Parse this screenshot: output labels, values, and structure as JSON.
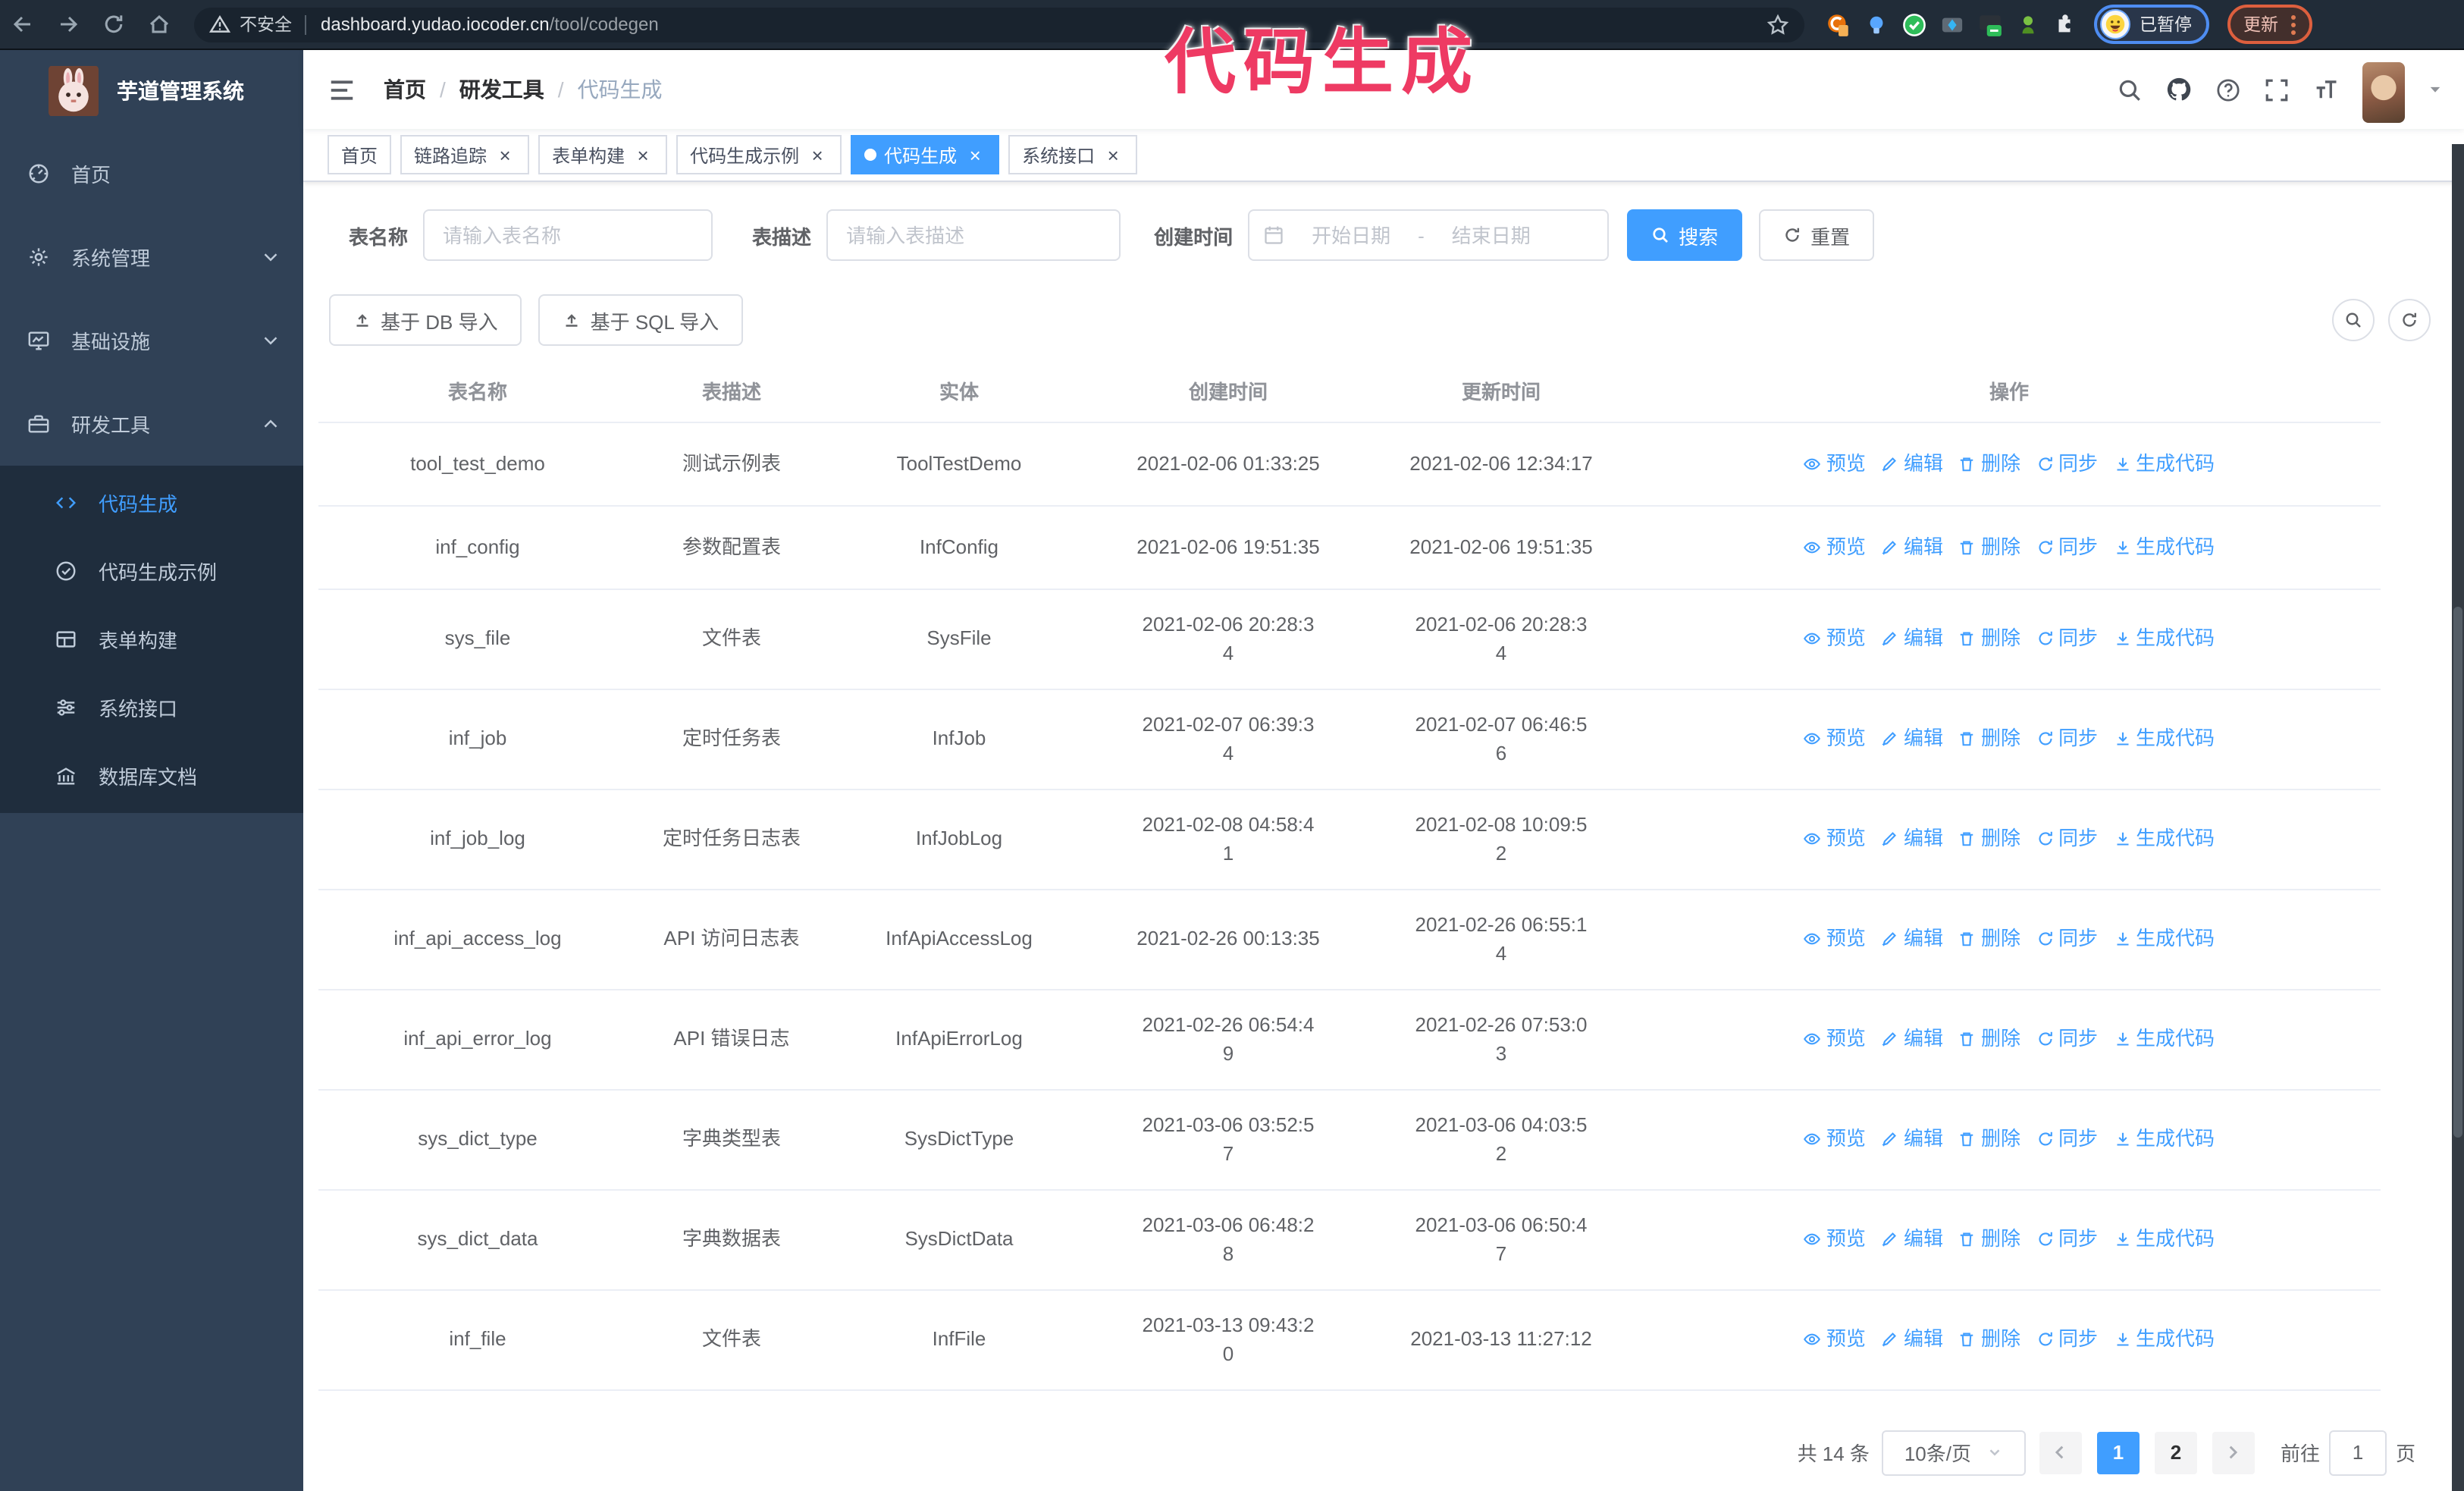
{
  "browser": {
    "security_label": "不安全",
    "url_host": "dashboard.yudao.iocoder.cn",
    "url_path": "/tool/codegen",
    "profile_badge": "已暂停",
    "update_label": "更新"
  },
  "annotation": {
    "text": "代码生成",
    "color": "#ee3a63"
  },
  "sidebar": {
    "title": "芋道管理系统",
    "items": [
      {
        "id": "home",
        "label": "首页",
        "icon": "dashboard-icon"
      },
      {
        "id": "system-mgmt",
        "label": "系统管理",
        "icon": "gear-icon",
        "arrow": "down"
      },
      {
        "id": "infrastructure",
        "label": "基础设施",
        "icon": "monitor-icon",
        "arrow": "down"
      },
      {
        "id": "dev-tools",
        "label": "研发工具",
        "icon": "suitcase-icon",
        "arrow": "up",
        "expanded": true
      }
    ],
    "submenu": [
      {
        "id": "codegen",
        "label": "代码生成",
        "icon": "code-icon",
        "active": true
      },
      {
        "id": "codegen-demo",
        "label": "代码生成示例",
        "icon": "badge-check-icon"
      },
      {
        "id": "form-builder",
        "label": "表单构建",
        "icon": "form-icon"
      },
      {
        "id": "system-api",
        "label": "系统接口",
        "icon": "sliders-icon"
      },
      {
        "id": "db-doc",
        "label": "数据库文档",
        "icon": "bank-icon"
      }
    ]
  },
  "header": {
    "breadcrumb": [
      "首页",
      "研发工具",
      "代码生成"
    ],
    "separator": "/"
  },
  "tabs": [
    {
      "label": "首页",
      "closable": false,
      "active": false
    },
    {
      "label": "链路追踪",
      "closable": true,
      "active": false
    },
    {
      "label": "表单构建",
      "closable": true,
      "active": false
    },
    {
      "label": "代码生成示例",
      "closable": true,
      "active": false
    },
    {
      "label": "代码生成",
      "closable": true,
      "active": true
    },
    {
      "label": "系统接口",
      "closable": true,
      "active": false
    }
  ],
  "ui": {
    "close_glyph": "×"
  },
  "filter": {
    "name_label": "表名称",
    "name_placeholder": "请输入表名称",
    "desc_label": "表描述",
    "desc_placeholder": "请输入表描述",
    "time_label": "创建时间",
    "start_placeholder": "开始日期",
    "range_separator": "-",
    "end_placeholder": "结束日期",
    "search_label": "搜索",
    "reset_label": "重置"
  },
  "toolbar": {
    "import_db_label": "基于 DB 导入",
    "import_sql_label": "基于 SQL 导入"
  },
  "table": {
    "columns": [
      "表名称",
      "表描述",
      "实体",
      "创建时间",
      "更新时间",
      "操作"
    ],
    "actions": [
      {
        "label": "预览",
        "icon": "eye-icon"
      },
      {
        "label": "编辑",
        "icon": "edit-icon"
      },
      {
        "label": "删除",
        "icon": "trash-icon"
      },
      {
        "label": "同步",
        "icon": "sync-icon"
      },
      {
        "label": "生成代码",
        "icon": "download-icon"
      }
    ],
    "rows": [
      {
        "name": "tool_test_demo",
        "desc": "测试示例表",
        "entity": "ToolTestDemo",
        "created": "2021-02-06 01:33:25",
        "updated": "2021-02-06 12:34:17"
      },
      {
        "name": "inf_config",
        "desc": "参数配置表",
        "entity": "InfConfig",
        "created": "2021-02-06 19:51:35",
        "updated": "2021-02-06 19:51:35"
      },
      {
        "name": "sys_file",
        "desc": "文件表",
        "entity": "SysFile",
        "created": "2021-02-06 20:28:3\n4",
        "updated": "2021-02-06 20:28:3\n4"
      },
      {
        "name": "inf_job",
        "desc": "定时任务表",
        "entity": "InfJob",
        "created": "2021-02-07 06:39:3\n4",
        "updated": "2021-02-07 06:46:5\n6"
      },
      {
        "name": "inf_job_log",
        "desc": "定时任务日志表",
        "entity": "InfJobLog",
        "created": "2021-02-08 04:58:4\n1",
        "updated": "2021-02-08 10:09:5\n2"
      },
      {
        "name": "inf_api_access_log",
        "desc": "API 访问日志表",
        "entity": "InfApiAccessLog",
        "created": "2021-02-26 00:13:35",
        "updated": "2021-02-26 06:55:1\n4"
      },
      {
        "name": "inf_api_error_log",
        "desc": "API 错误日志",
        "entity": "InfApiErrorLog",
        "created": "2021-02-26 06:54:4\n9",
        "updated": "2021-02-26 07:53:0\n3"
      },
      {
        "name": "sys_dict_type",
        "desc": "字典类型表",
        "entity": "SysDictType",
        "created": "2021-03-06 03:52:5\n7",
        "updated": "2021-03-06 04:03:5\n2"
      },
      {
        "name": "sys_dict_data",
        "desc": "字典数据表",
        "entity": "SysDictData",
        "created": "2021-03-06 06:48:2\n8",
        "updated": "2021-03-06 06:50:4\n7"
      },
      {
        "name": "inf_file",
        "desc": "文件表",
        "entity": "InfFile",
        "created": "2021-03-13 09:43:2\n0",
        "updated": "2021-03-13 11:27:12"
      }
    ]
  },
  "pagination": {
    "total_label": "共 14 条",
    "page_size_label": "10条/页",
    "pages": [
      "1",
      "2"
    ],
    "active_page": "1",
    "goto_label": "前往",
    "goto_value": "1",
    "goto_suffix": "页"
  },
  "colors": {
    "accent": "#409eff",
    "sidebar_bg": "#304156",
    "submenu_bg": "#1f2d3d",
    "annotation": "#ee3a63",
    "tag_active": "#409eff",
    "link": "#409eff"
  }
}
